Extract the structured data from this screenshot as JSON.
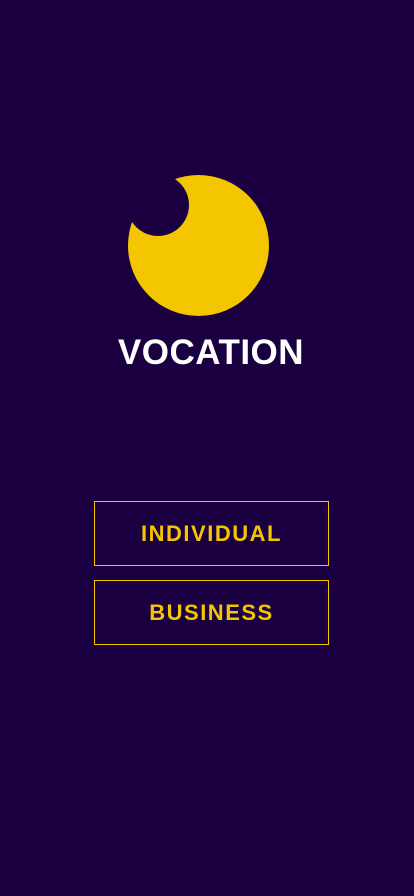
{
  "app": {
    "brand_name": "VOCATION",
    "logo_icon": "crescent-moon-logo-icon"
  },
  "colors": {
    "background": "#1a0040",
    "accent": "#f3c600",
    "text": "#ffffff"
  },
  "actions": {
    "individual_label": "INDIVIDUAL",
    "business_label": "BUSINESS"
  }
}
